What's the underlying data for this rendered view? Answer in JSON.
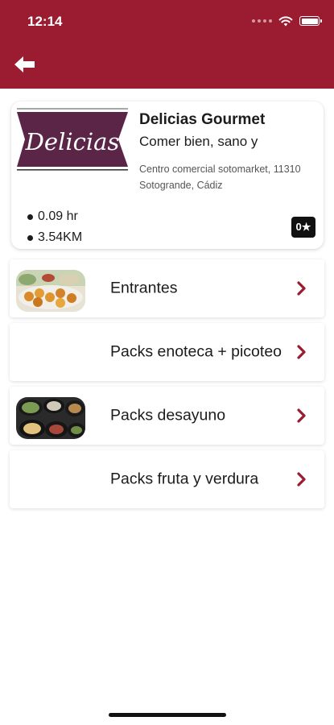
{
  "status_bar": {
    "time": "12:14"
  },
  "header": {
    "back_icon": "arrow-left-icon",
    "background": "#9b1b30"
  },
  "store": {
    "logo_text": "Delicias",
    "name": "Delicias Gourmet",
    "tagline": "Comer bien, sano y",
    "address": "Centro comercial sotomarket, 11310 Sotogrande, Cádiz",
    "time": "0.09 hr",
    "distance": "3.54KM",
    "rating": "0★"
  },
  "categories": [
    {
      "label": "Entrantes",
      "has_image": true
    },
    {
      "label": "Packs enoteca + picoteo",
      "has_image": false
    },
    {
      "label": "Packs desayuno",
      "has_image": true
    },
    {
      "label": "Packs fruta y verdura",
      "has_image": false
    }
  ],
  "colors": {
    "brand": "#9b1b30",
    "logo_bg": "#5b2547",
    "accent": "#9b1b30"
  }
}
